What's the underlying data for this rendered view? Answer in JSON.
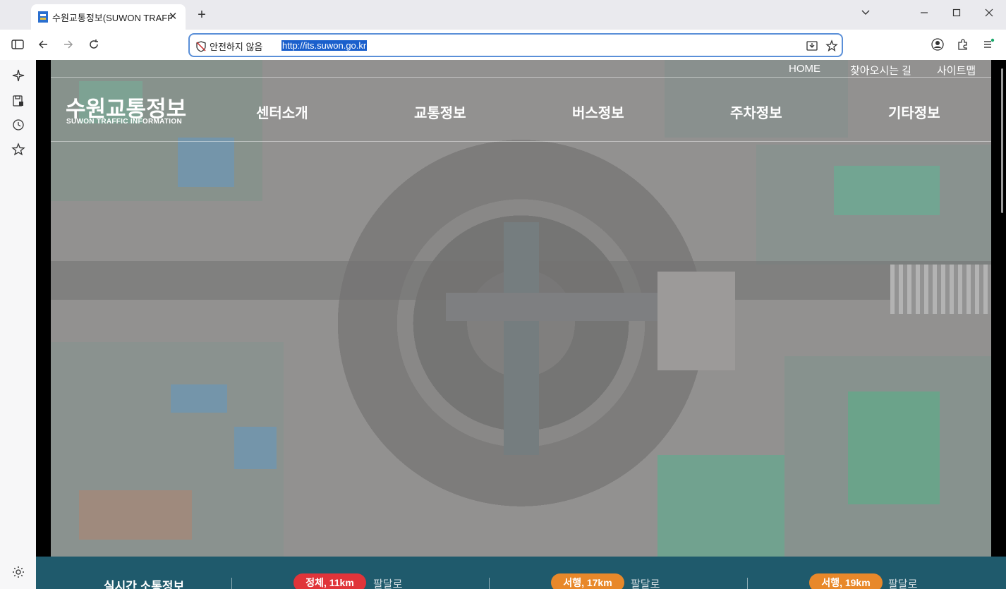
{
  "browser": {
    "tab_title": "수원교통정보(SUWON TRAFFIC",
    "tab_close": "✕",
    "new_tab": "+",
    "win_dropdown": "⌄",
    "win_minimize": "—",
    "win_maximize": "▢",
    "win_close": "✕",
    "security_label": "안전하지 않음",
    "url": "http://its.suwon.go.kr"
  },
  "site": {
    "utility_links": [
      "HOME",
      "찾아오시는 길",
      "사이트맵"
    ],
    "logo_ko": "수원교통정보",
    "logo_en": "SUWON TRAFFIC INFORMATION",
    "nav": [
      "센터소개",
      "교통정보",
      "버스정보",
      "주차정보",
      "기타정보"
    ]
  },
  "status_bar": {
    "heading": "실시간 소통정보",
    "items": [
      {
        "badge": "정체, 11km",
        "road": "팔달로",
        "color": "#e0343a"
      },
      {
        "badge": "서행, 17km",
        "road": "팔달로",
        "color": "#e8882a"
      },
      {
        "badge": "서행, 19km",
        "road": "팔달로",
        "color": "#e8882a"
      }
    ]
  },
  "icons": {
    "sidebar": [
      "sidebar-toggle-icon",
      "back-arrow-icon",
      "forward-arrow-icon",
      "reload-icon"
    ],
    "side_panel": [
      "ai-sparkle-icon",
      "save-page-icon",
      "history-icon",
      "favorites-star-icon",
      "settings-gear-icon"
    ]
  }
}
